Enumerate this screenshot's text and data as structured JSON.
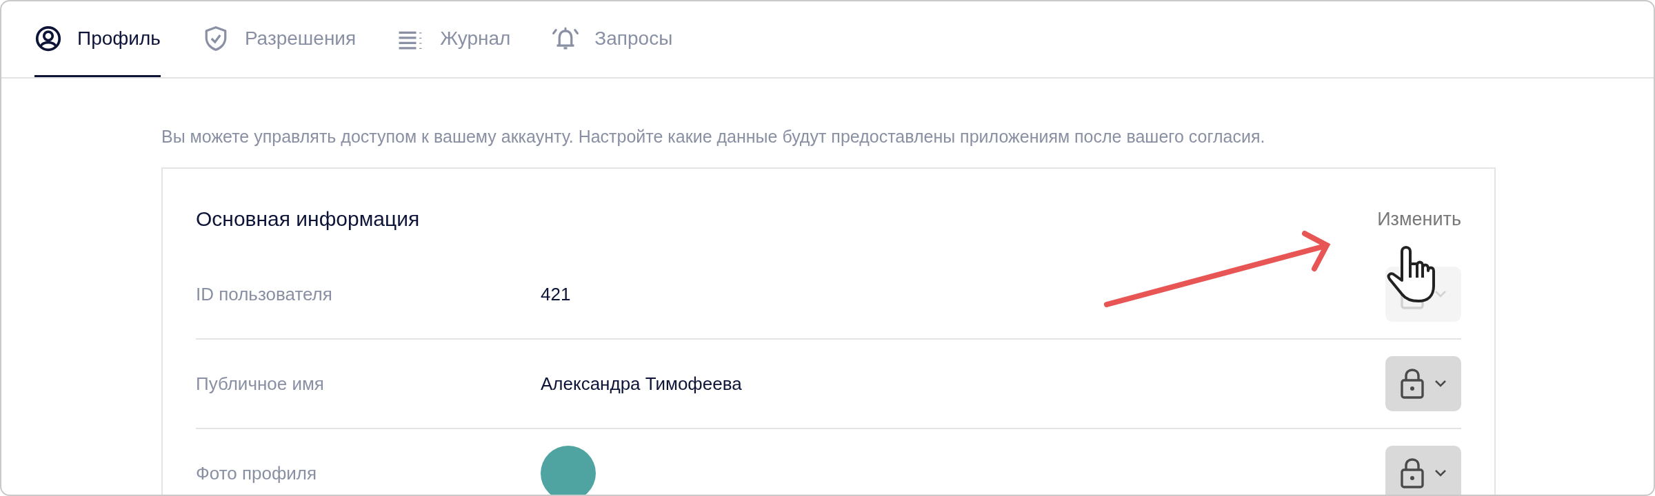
{
  "tabs": [
    {
      "label": "Профиль",
      "selected": true
    },
    {
      "label": "Разрешения",
      "selected": false
    },
    {
      "label": "Журнал",
      "selected": false
    },
    {
      "label": "Запросы",
      "selected": false
    }
  ],
  "description": "Вы можете управлять доступом к вашему аккаунту. Настройте какие данные будут предоставлены приложениям после вашего согласия.",
  "card": {
    "title": "Основная информация",
    "edit_link": "Изменить",
    "rows": [
      {
        "label": "ID пользователя",
        "kind": "text",
        "value": "421",
        "disabled": true
      },
      {
        "label": "Публичное имя",
        "kind": "text",
        "value": "Александра Тимофеева",
        "disabled": false
      },
      {
        "label": "Фото профиля",
        "kind": "photo",
        "disabled": false
      }
    ]
  }
}
